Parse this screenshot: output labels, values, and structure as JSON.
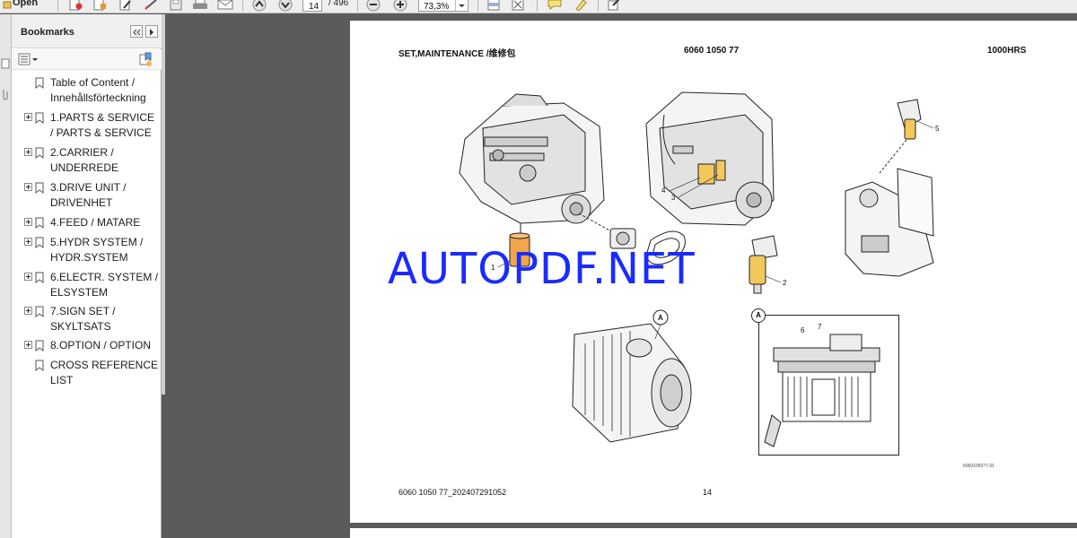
{
  "toolbar": {
    "open_label": "Open",
    "page_current": "14",
    "page_total": "/ 496",
    "zoom": "73,3%"
  },
  "bookmarks": {
    "title": "Bookmarks",
    "items": [
      {
        "label": "Table of Content / Innehållsförteckning",
        "expandable": false
      },
      {
        "label": "1.PARTS & SERVICE / PARTS & SERVICE",
        "expandable": true
      },
      {
        "label": "2.CARRIER / UNDERREDE",
        "expandable": true
      },
      {
        "label": "3.DRIVE UNIT / DRIVENHET",
        "expandable": true
      },
      {
        "label": "4.FEED / MATARE",
        "expandable": true
      },
      {
        "label": "5.HYDR SYSTEM / HYDR.SYSTEM",
        "expandable": true
      },
      {
        "label": "6.ELECTR. SYSTEM / ELSYSTEM",
        "expandable": true
      },
      {
        "label": "7.SIGN SET / SKYLTSATS",
        "expandable": true
      },
      {
        "label": "8.OPTION / OPTION",
        "expandable": true
      },
      {
        "label": "CROSS REFERENCE LIST",
        "expandable": false
      }
    ]
  },
  "document": {
    "title": "SET,MAINTENANCE /维修包",
    "part_number": "6060 1050 77",
    "interval": "1000HRS",
    "footer_code": "6060 1050 77_202407291052",
    "page_number": "14",
    "drawing_id": "6060105077-01",
    "callouts": [
      "1",
      "2",
      "3",
      "4",
      "5",
      "6",
      "7"
    ],
    "detail_marker": "A",
    "watermark": "AUTOPDF.NET"
  },
  "colors": {
    "viewer_background": "#5b5b5b",
    "watermark": "#1a2bff",
    "filter_highlight": "#f2a54a"
  }
}
